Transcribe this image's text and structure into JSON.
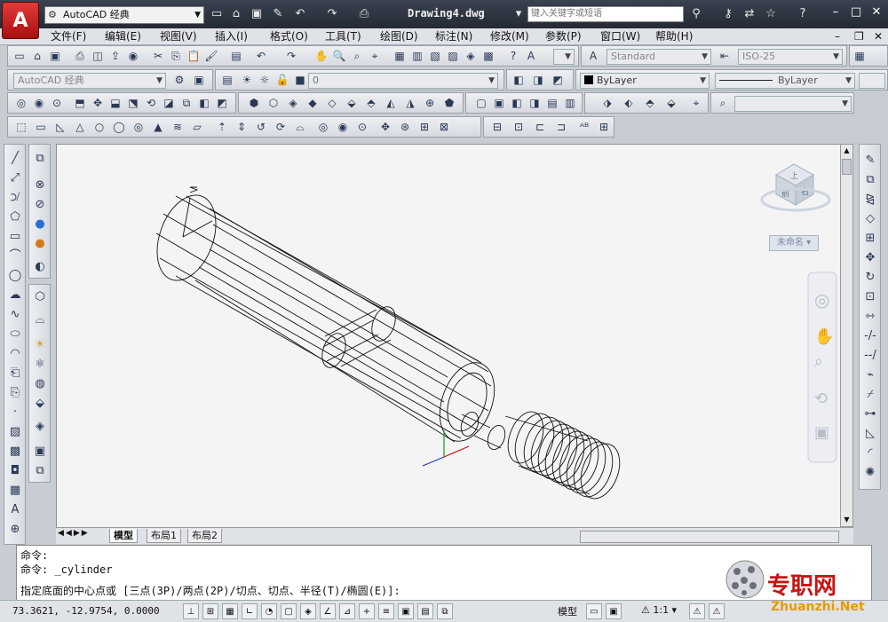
{
  "titlebar": {
    "workspace": "AutoCAD 经典",
    "document_title": "Drawing4.dwg",
    "search_placeholder": "键入关键字或短语"
  },
  "menu": [
    "文件(F)",
    "编辑(E)",
    "视图(V)",
    "插入(I)",
    "格式(O)",
    "工具(T)",
    "绘图(D)",
    "标注(N)",
    "修改(M)",
    "参数(P)",
    "窗口(W)",
    "帮助(H)"
  ],
  "styles": {
    "text_style": "Standard",
    "dim_style": "ISO-25"
  },
  "layers": {
    "layer_combo": "0",
    "color": "ByLayer",
    "linetype": "ByLayer"
  },
  "viewcube": {
    "top": "上",
    "front": "前",
    "right": "右",
    "ucs_label": "未命名"
  },
  "tabs": [
    "模型",
    "布局1",
    "布局2"
  ],
  "command": {
    "line1": "命令:",
    "line2": "命令: _cylinder",
    "line3": "指定底面的中心点或 [三点(3P)/两点(2P)/切点、切点、半径(T)/椭圆(E)]:"
  },
  "status": {
    "coords": "73.3621,  -12.9754, 0.0000",
    "model": "模型",
    "scale": "1:1"
  },
  "watermark": {
    "text": "专职网",
    "domain": "Zhuanzhi.Net"
  },
  "colors": {
    "titlebar": "#2b313c",
    "logo_red": "#c41a1a",
    "canvas": "#f4f4f4"
  }
}
